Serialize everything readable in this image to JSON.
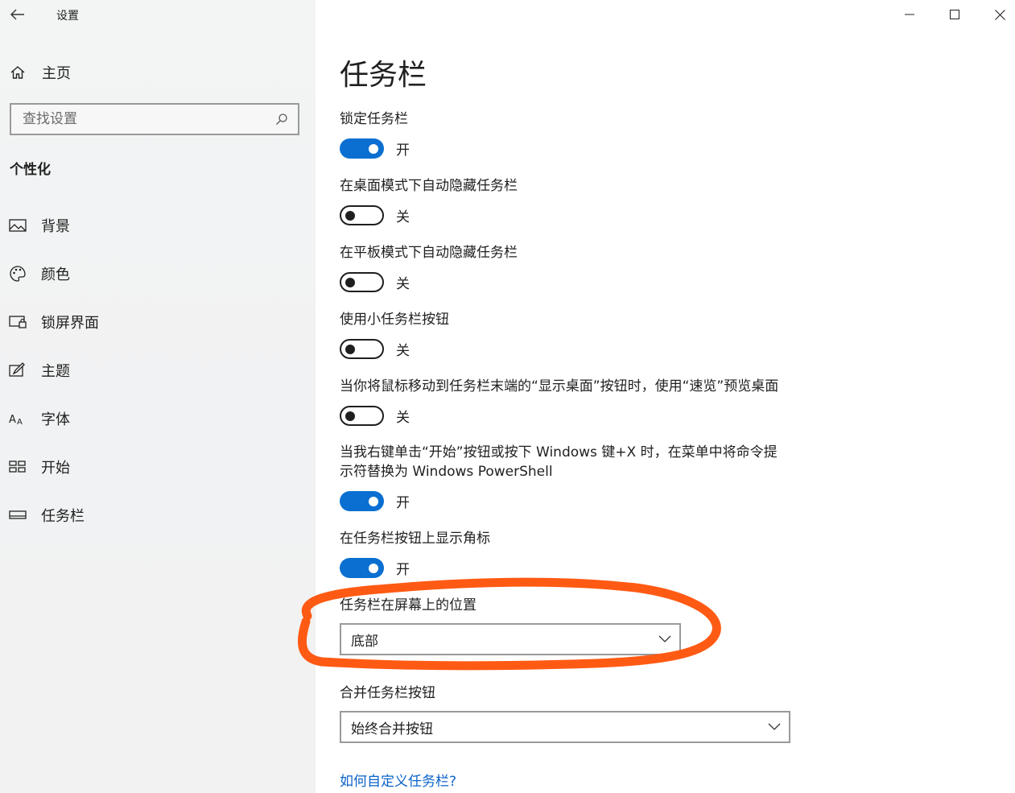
{
  "window": {
    "app_title": "设置"
  },
  "sidebar": {
    "home_label": "主页",
    "search_placeholder": "查找设置",
    "section_title": "个性化",
    "items": [
      {
        "label": "背景",
        "icon": "picture-icon"
      },
      {
        "label": "颜色",
        "icon": "palette-icon"
      },
      {
        "label": "锁屏界面",
        "icon": "lockscreen-icon"
      },
      {
        "label": "主题",
        "icon": "theme-icon"
      },
      {
        "label": "字体",
        "icon": "font-icon"
      },
      {
        "label": "开始",
        "icon": "start-icon"
      },
      {
        "label": "任务栏",
        "icon": "taskbar-icon"
      }
    ]
  },
  "main": {
    "title": "任务栏",
    "settings": [
      {
        "label": "锁定任务栏",
        "state": "开",
        "on": true
      },
      {
        "label": "在桌面模式下自动隐藏任务栏",
        "state": "关",
        "on": false
      },
      {
        "label": "在平板模式下自动隐藏任务栏",
        "state": "关",
        "on": false
      },
      {
        "label": "使用小任务栏按钮",
        "state": "关",
        "on": false
      },
      {
        "label": "当你将鼠标移动到任务栏末端的“显示桌面”按钮时，使用“速览”预览桌面",
        "state": "关",
        "on": false
      },
      {
        "label": "当我右键单击“开始”按钮或按下 Windows 键+X 时，在菜单中将命令提示符替换为 Windows PowerShell",
        "state": "开",
        "on": true
      },
      {
        "label": "在任务栏按钮上显示角标",
        "state": "开",
        "on": true
      }
    ],
    "position": {
      "label": "任务栏在屏幕上的位置",
      "value": "底部"
    },
    "combine": {
      "label": "合并任务栏按钮",
      "value": "始终合并按钮"
    },
    "help_link": "如何自定义任务栏?"
  },
  "colors": {
    "accent": "#0a6fd1",
    "annotation": "#ff5a14",
    "link": "#0a63c9"
  }
}
